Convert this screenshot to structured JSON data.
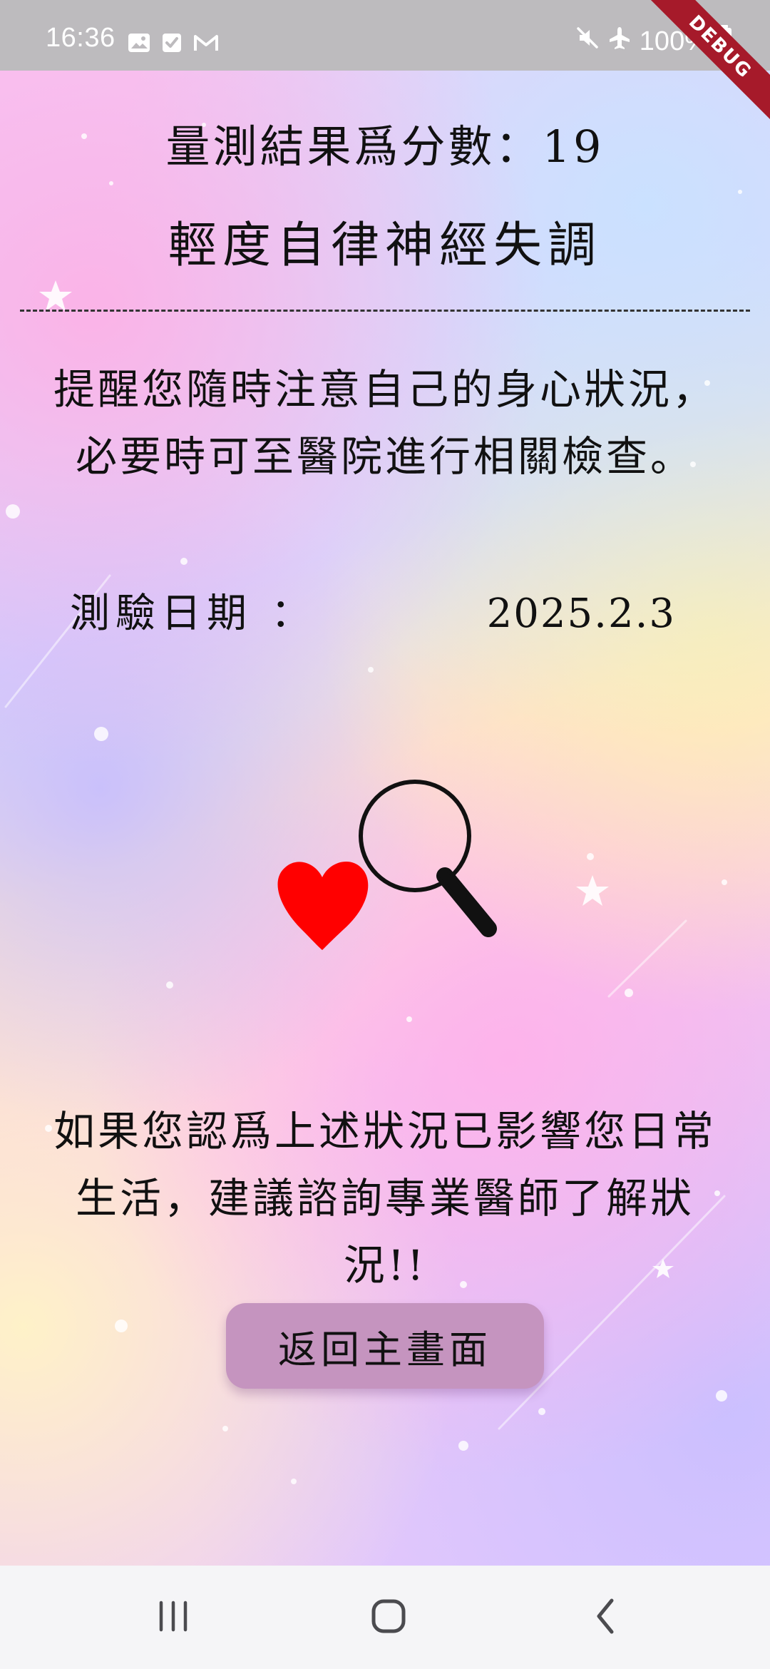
{
  "status_bar": {
    "time": "16:36",
    "battery": "100%"
  },
  "debug_banner": {
    "text": "DEBUG"
  },
  "result": {
    "score_text": "量測結果爲分數：19",
    "level_text": "輕度自律神經失調"
  },
  "reminder": {
    "text": "提醒您隨時注意自己的身心狀況，必要時可至醫院進行相關檢查。"
  },
  "test_date": {
    "label": "測驗日期 ：",
    "value": "2025.2.3"
  },
  "advice": {
    "text": "如果您認爲上述狀況已影響您日常生活，建議諮詢專業醫師了解狀況!!"
  },
  "actions": {
    "back_button_label": "返回主畫面"
  },
  "icons": {
    "status_left": [
      "image-icon",
      "check-icon",
      "mail-icon"
    ],
    "status_right": [
      "mute-icon",
      "airplane-mode-icon",
      "battery-icon"
    ],
    "illustration": [
      "heart-icon",
      "magnifying-glass-icon"
    ],
    "navigation": [
      "recent-apps-icon",
      "home-icon",
      "back-icon"
    ]
  },
  "colors": {
    "button_background": "#c594bf",
    "heart": "#ff0000",
    "debug_banner": "#a61a2a"
  }
}
